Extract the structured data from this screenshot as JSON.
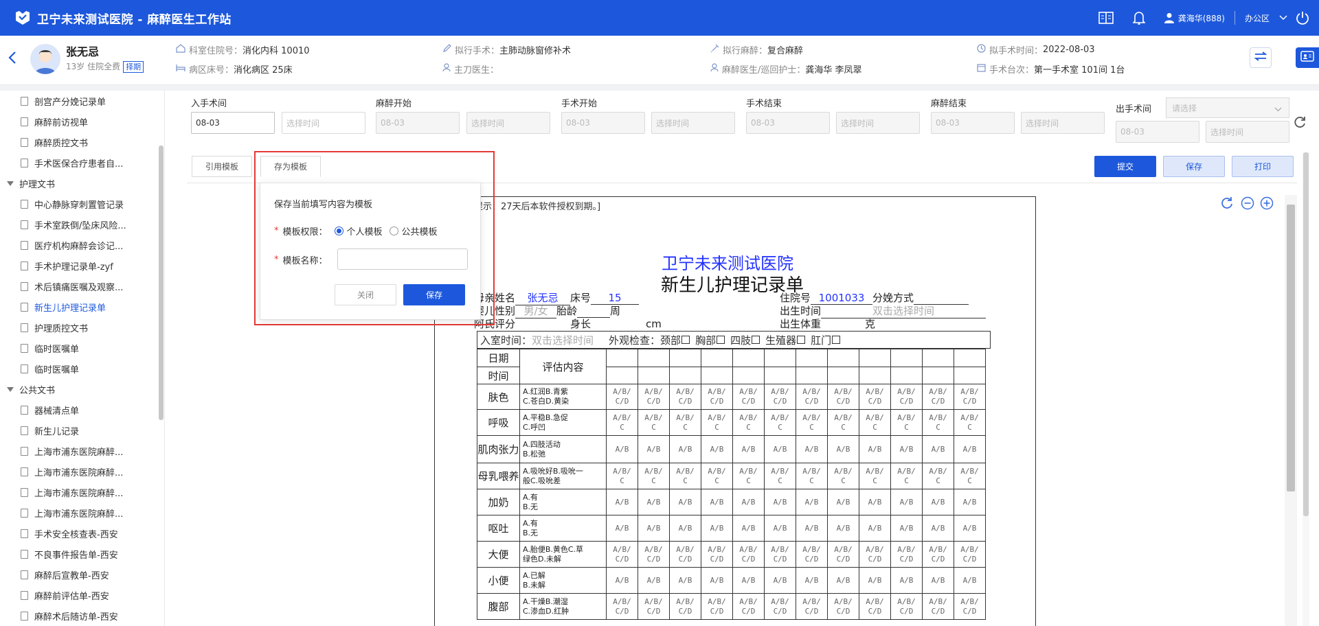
{
  "app": {
    "title": "卫宁未来测试医院 - 麻醉医生工作站",
    "user": "龚海华(888)",
    "office": "办公区"
  },
  "patient": {
    "name": "张无忌",
    "info": "13岁 住院全费",
    "badge": "择期",
    "dept_label": "科室住院号：",
    "dept_value": "消化内科 10010",
    "ward_label": "病区床号：",
    "ward_value": "消化病区 25床",
    "surgery_label": "拟行手术：",
    "surgery_value": "主肺动脉窗修补术",
    "surgeon_label": "主刀医生：",
    "surgeon_value": "",
    "anes_label": "拟行麻醉：",
    "anes_value": "复合麻醉",
    "staff_label": "麻醉医生/巡回护士：",
    "staff_value": "龚海华 李凤翠",
    "time_label": "拟手术时间：",
    "time_value": "2022-08-03",
    "room_label": "手术台次：",
    "room_value": "第一手术室 101间 1台"
  },
  "sidebar": {
    "items_top": [
      "剖宫产分娩记录单",
      "麻醉前访视单",
      "麻醉质控文书",
      "手术医保合疗患者自..."
    ],
    "group_nursing": "护理文书",
    "items_nursing": [
      "中心静脉穿刺置管记录",
      "手术室跌倒/坠床风险...",
      "医疗机构麻醉会诊记...",
      "手术护理记录单-zyf",
      "术后镇痛医嘱及观察...",
      "新生儿护理记录单",
      "护理质控文书",
      "临时医嘱单",
      "临时医嘱单"
    ],
    "group_public": "公共文书",
    "items_public": [
      "器械清点单",
      "新生儿记录",
      "上海市浦东医院麻醉...",
      "上海市浦东医院麻醉...",
      "上海市浦东医院麻醉...",
      "上海市浦东医院麻醉...",
      "手术安全核查表-西安",
      "不良事件报告单-西安",
      "麻醉后宣教单-西安",
      "麻醉前评估单-西安",
      "麻醉术后随访单-西安"
    ]
  },
  "times": {
    "in_room": "入手术间",
    "in_room_date": "08-03",
    "anes_start": "麻醉开始",
    "surg_start": "手术开始",
    "surg_end": "手术结束",
    "anes_end": "麻醉结束",
    "out_room": "出手术间",
    "date_placeholder": "08-03",
    "time_placeholder": "选择时间",
    "select_placeholder": "请选择"
  },
  "toolbar": {
    "cite_template": "引用模板",
    "save_template": "存为模板",
    "submit": "提交",
    "save": "保存",
    "print": "打印"
  },
  "popover": {
    "title": "保存当前填写内容为模板",
    "perm_label": "模板权限：",
    "opt_personal": "个人模板",
    "opt_public": "公共模板",
    "name_label": "模板名称：",
    "close": "关闭",
    "save": "保存"
  },
  "document": {
    "notice": "提示：27天后本软件授权到期。]",
    "hospital": "卫宁未来测试医院",
    "title": "新生儿护理记录单",
    "mother_label": "母亲姓名",
    "mother_value": "张无忌",
    "bed_label": "床号",
    "bed_value": "15",
    "admission_label": "住院号",
    "admission_value": "1001033",
    "delivery_label": "分娩方式",
    "sex_label": "婴儿性别",
    "sex_value": "男/女",
    "ga_label": "胎龄",
    "ga_unit": "周",
    "birth_label": "出生时间",
    "birth_value": "双击选择时间",
    "apgar_label": "阿氏评分",
    "length_label": "身长",
    "length_unit": "cm",
    "weight_label": "出生体重",
    "weight_unit": "克",
    "entry_label": "入室时间：",
    "entry_value": "双击选择时间",
    "exam_label": "外观检查：",
    "exam_items": [
      "颈部",
      "胸部",
      "四肢",
      "生殖器",
      "肛门"
    ],
    "date_h": "日期",
    "time_h": "时间",
    "content_h": "评估内容",
    "rows": [
      {
        "label": "肤色",
        "c1": "A.红润B.青紫",
        "c2": "C.苍白D.黄染",
        "v1": "A/B/",
        "v2": "C/D"
      },
      {
        "label": "呼吸",
        "c1": "A.平稳B.急促",
        "c2": "C.呼凹",
        "v1": "A/B/",
        "v2": "C"
      },
      {
        "label": "肌肉张力",
        "c1": "A.四肢活动",
        "c2": "B.松弛",
        "v1": "A/B",
        "v2": ""
      },
      {
        "label": "母乳喂养",
        "c1": "A.吸吮好B.吸吮一",
        "c2": "般C.吸吮差",
        "v1": "A/B/",
        "v2": "C"
      },
      {
        "label": "加奶",
        "c1": "A.有",
        "c2": "B.无",
        "v1": "A/B",
        "v2": ""
      },
      {
        "label": "呕吐",
        "c1": "A.有",
        "c2": "B.无",
        "v1": "A/B",
        "v2": ""
      },
      {
        "label": "大便",
        "c1": "A.胎便B.黄色C.草",
        "c2": "绿色D.未解",
        "v1": "A/B/",
        "v2": "C/D"
      },
      {
        "label": "小便",
        "c1": "A.已解",
        "c2": "B.未解",
        "v1": "A/B",
        "v2": ""
      },
      {
        "label": "腹部",
        "c1": "A.干燥B.潮湿",
        "c2": "C.渗血D.红肿",
        "v1": "A/B/",
        "v2": "C/D"
      }
    ]
  }
}
